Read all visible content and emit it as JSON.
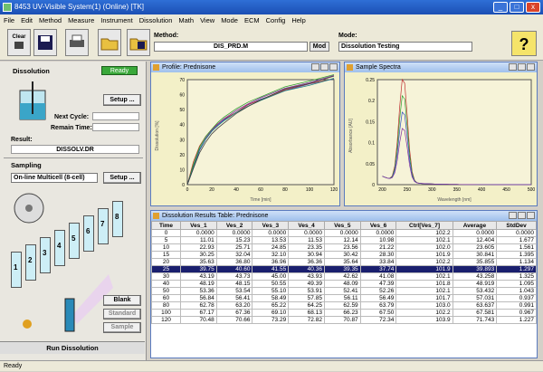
{
  "window": {
    "title": "8453 UV-Visible System(1) (Online) [TK]",
    "min": "_",
    "max": "□",
    "close": "x"
  },
  "menu": [
    "File",
    "Edit",
    "Method",
    "Measure",
    "Instrument",
    "Dissolution",
    "Math",
    "View",
    "Mode",
    "ECM",
    "Config",
    "Help"
  ],
  "toolbar": {
    "clear_label": "Clear",
    "method_label": "Method:",
    "method_value": "DIS_PRD.M",
    "mod_label": "Mod",
    "mode_label": "Mode:",
    "mode_value": "Dissolution Testing",
    "help": "?"
  },
  "left": {
    "dissolution_title": "Dissolution",
    "ready": "Ready",
    "setup": "Setup ...",
    "next_cycle": "Next Cycle:",
    "remain_time": "Remain Time:",
    "result_label": "Result:",
    "result_value": "DISSOLV.DR",
    "sampling_title": "Sampling",
    "sampling_value": "On-line Multicell (8-cell)",
    "setup2": "Setup ...",
    "cells": [
      "1",
      "2",
      "3",
      "4",
      "5",
      "6",
      "7",
      "8"
    ],
    "blank": "Blank",
    "standard": "Standard",
    "sample": "Sample",
    "run": "Run Dissolution"
  },
  "profile": {
    "title": "Profile: Prednisone",
    "xlabel": "Time [min]",
    "ylabel": "Dissolution [%]"
  },
  "spectra": {
    "title": "Sample Spectra",
    "xlabel": "Wavelength [nm]",
    "ylabel": "Absorbance [AU]"
  },
  "table": {
    "title": "Dissolution Results Table: Prednisone",
    "headers": [
      "Time",
      "Ves_1",
      "Ves_2",
      "Ves_3",
      "Ves_4",
      "Ves_5",
      "Ves_6",
      "Ctrl[Ves_7]",
      "Average",
      "StdDev"
    ],
    "rows": [
      [
        "0",
        "0.0000",
        "0.0000",
        "0.0000",
        "0.0000",
        "0.0000",
        "0.0000",
        "102.2",
        "0.0000",
        "0.0000"
      ],
      [
        "5",
        "11.01",
        "15.23",
        "13.53",
        "11.53",
        "12.14",
        "10.98",
        "102.1",
        "12.404",
        "1.677"
      ],
      [
        "10",
        "22.93",
        "25.71",
        "24.85",
        "23.35",
        "23.56",
        "21.22",
        "102.0",
        "23.605",
        "1.561"
      ],
      [
        "15",
        "30.25",
        "32.04",
        "32.10",
        "30.94",
        "30.42",
        "28.30",
        "101.9",
        "30.841",
        "1.395"
      ],
      [
        "20",
        "35.63",
        "36.80",
        "36.96",
        "36.36",
        "35.64",
        "33.84",
        "102.2",
        "35.855",
        "1.134"
      ],
      [
        "25",
        "39.75",
        "40.60",
        "41.55",
        "40.36",
        "39.35",
        "37.74",
        "101.9",
        "39.893",
        "1.297"
      ],
      [
        "30",
        "43.19",
        "43.73",
        "45.00",
        "43.93",
        "42.62",
        "41.08",
        "102.1",
        "43.258",
        "1.325"
      ],
      [
        "40",
        "48.19",
        "48.15",
        "50.55",
        "49.39",
        "48.09",
        "47.39",
        "101.8",
        "48.919",
        "1.095"
      ],
      [
        "50",
        "53.36",
        "53.54",
        "55.10",
        "53.91",
        "52.41",
        "52.26",
        "102.1",
        "53.432",
        "1.043"
      ],
      [
        "60",
        "56.84",
        "56.41",
        "58.49",
        "57.85",
        "56.11",
        "56.49",
        "101.7",
        "57.031",
        "0.937"
      ],
      [
        "80",
        "62.78",
        "63.20",
        "65.22",
        "64.25",
        "62.59",
        "63.79",
        "103.0",
        "63.637",
        "0.991"
      ],
      [
        "100",
        "67.17",
        "67.36",
        "69.10",
        "68.13",
        "66.23",
        "67.50",
        "102.2",
        "67.581",
        "0.967"
      ],
      [
        "120",
        "70.48",
        "70.66",
        "73.29",
        "72.82",
        "70.87",
        "72.34",
        "103.9",
        "71.743",
        "1.227"
      ]
    ],
    "selected_row": 5
  },
  "statusbar": "Ready",
  "chart_data": [
    {
      "type": "line",
      "title": "Profile: Prednisone",
      "xlabel": "Time [min]",
      "ylabel": "Dissolution [%]",
      "xlim": [
        0,
        120
      ],
      "ylim": [
        0,
        70
      ],
      "x": [
        0,
        5,
        10,
        15,
        20,
        25,
        30,
        40,
        50,
        60,
        80,
        100,
        120
      ],
      "series": [
        {
          "name": "Ves_1",
          "values": [
            0,
            11.01,
            22.93,
            30.25,
            35.63,
            39.75,
            43.19,
            48.19,
            53.36,
            56.84,
            62.78,
            67.17,
            70.48
          ]
        },
        {
          "name": "Ves_2",
          "values": [
            0,
            15.23,
            25.71,
            32.04,
            36.8,
            40.6,
            43.73,
            48.15,
            53.54,
            56.41,
            63.2,
            67.36,
            70.66
          ]
        },
        {
          "name": "Ves_3",
          "values": [
            0,
            13.53,
            24.85,
            32.1,
            36.96,
            41.55,
            45.0,
            50.55,
            55.1,
            58.49,
            65.22,
            69.1,
            73.29
          ]
        },
        {
          "name": "Ves_4",
          "values": [
            0,
            11.53,
            23.35,
            30.94,
            36.36,
            40.36,
            43.93,
            49.39,
            53.91,
            57.85,
            64.25,
            68.13,
            72.82
          ]
        },
        {
          "name": "Ves_5",
          "values": [
            0,
            12.14,
            23.56,
            30.42,
            35.64,
            39.35,
            42.62,
            48.09,
            52.41,
            56.11,
            62.59,
            66.23,
            70.87
          ]
        },
        {
          "name": "Ves_6",
          "values": [
            0,
            10.98,
            21.22,
            28.3,
            33.84,
            37.74,
            41.08,
            47.39,
            52.26,
            56.49,
            63.79,
            67.5,
            72.34
          ]
        }
      ]
    },
    {
      "type": "line",
      "title": "Sample Spectra",
      "xlabel": "Wavelength [nm]",
      "ylabel": "Absorbance [AU]",
      "xlim": [
        190,
        500
      ],
      "ylim": [
        0,
        0.25
      ]
    }
  ],
  "colors": {
    "selected_row": "#1a1f6e",
    "ready": "#3aa83a"
  }
}
